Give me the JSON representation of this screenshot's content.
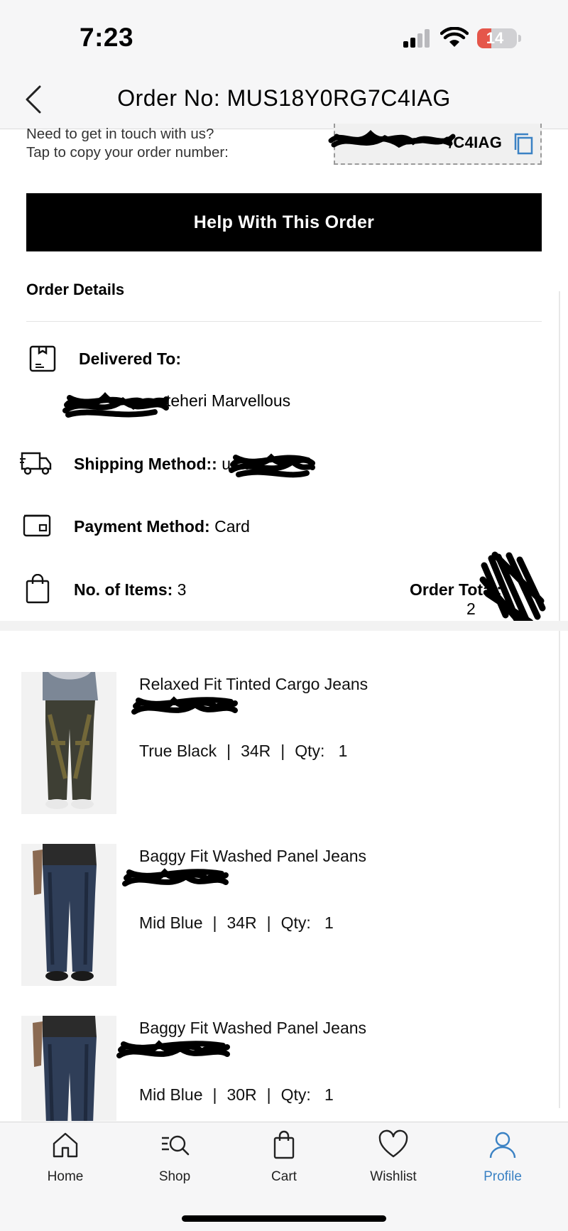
{
  "status_bar": {
    "time": "7:23",
    "battery": "14"
  },
  "header": {
    "title": "Order No: MUS18Y0RG7C4IAG"
  },
  "contact": {
    "line1": "Need to get in touch with us?",
    "line2": "Tap to copy your order number:",
    "order_number_visible": "/C4IAG"
  },
  "help_button": "Help With This Order",
  "order_details": {
    "title": "Order Details",
    "delivered_to_label": "Delivered To:",
    "delivered_to_name": "teheri Marvellous",
    "shipping_label": "Shipping Method::",
    "shipping_value": "usa",
    "payment_label": "Payment Method:",
    "payment_value": "Card",
    "items_label": "No. of Items:",
    "items_value": "3",
    "total_label": "Order Total:",
    "total_value": "2"
  },
  "items": [
    {
      "name": "Relaxed Fit Tinted Cargo Jeans",
      "color": "True Black",
      "size": "34R",
      "qty_label": "Qty:",
      "qty": "1"
    },
    {
      "name": "Baggy Fit Washed Panel Jeans",
      "color": "Mid Blue",
      "size": "34R",
      "qty_label": "Qty:",
      "qty": "1"
    },
    {
      "name": "Baggy Fit Washed Panel Jeans",
      "color": "Mid Blue",
      "size": "30R",
      "qty_label": "Qty:",
      "qty": "1"
    }
  ],
  "tabs": [
    {
      "label": "Home",
      "icon": "home-icon"
    },
    {
      "label": "Shop",
      "icon": "shop-search-icon"
    },
    {
      "label": "Cart",
      "icon": "cart-bag-icon"
    },
    {
      "label": "Wishlist",
      "icon": "heart-icon"
    },
    {
      "label": "Profile",
      "icon": "profile-icon",
      "active": true
    }
  ],
  "colors": {
    "accent": "#3b82c4",
    "button": "#000000",
    "battery_low": "#e5564a"
  }
}
